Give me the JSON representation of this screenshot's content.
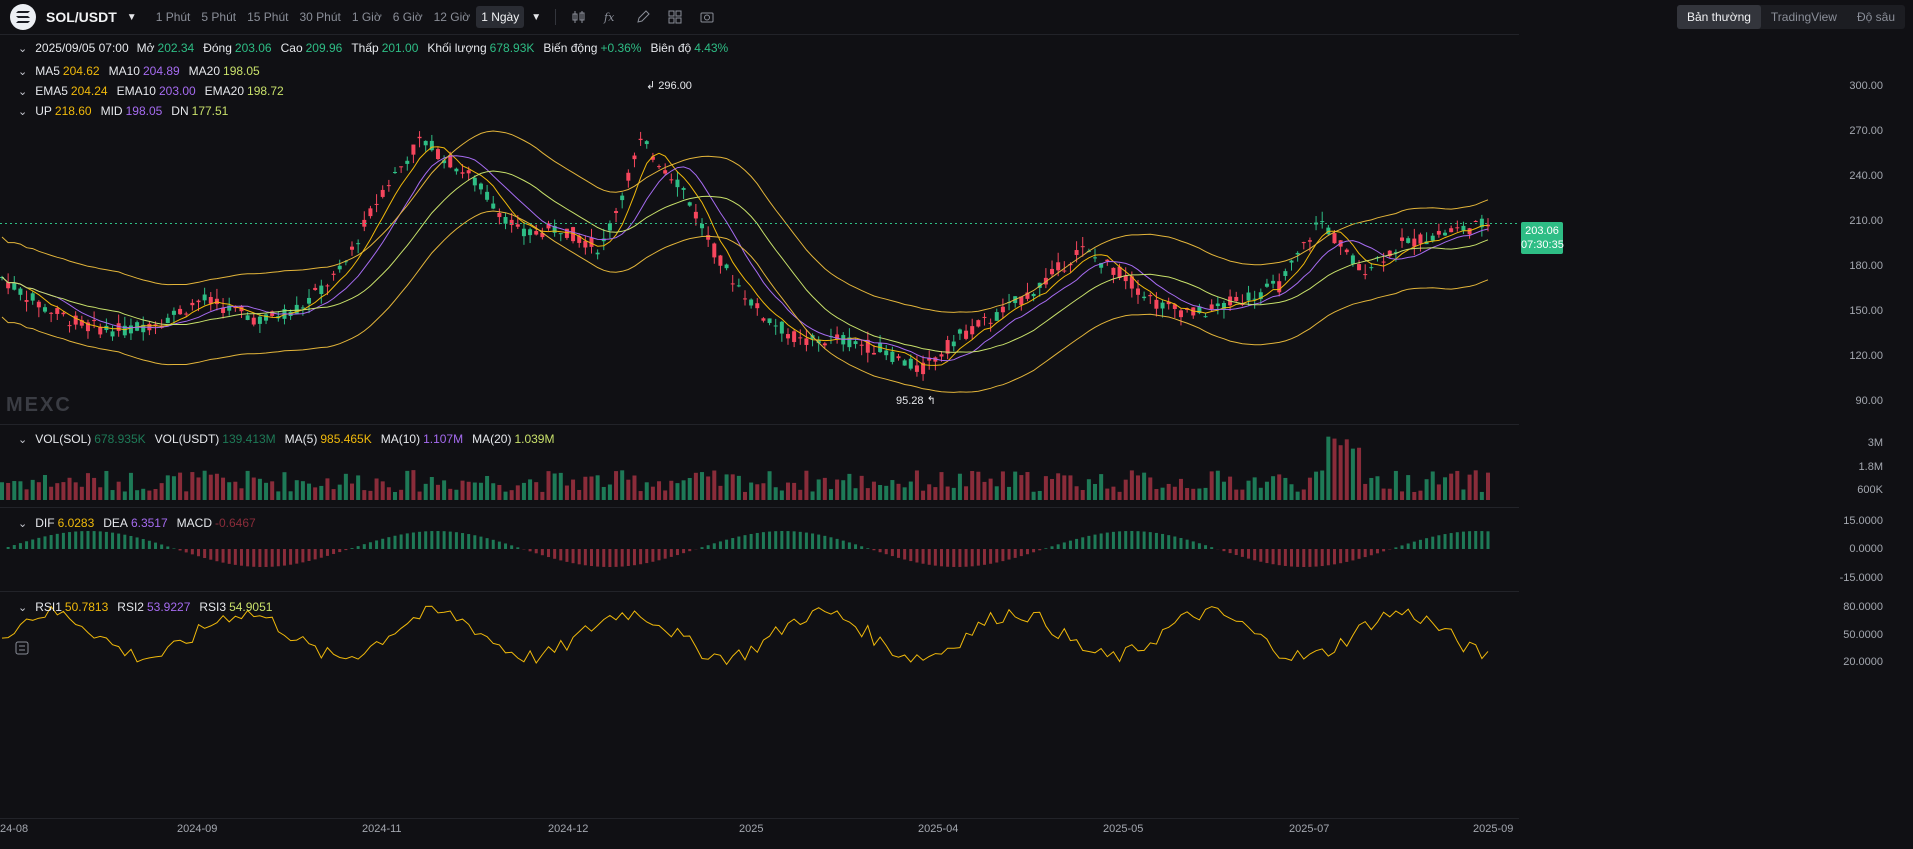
{
  "header": {
    "pair": "SOL/USDT",
    "timeframes": [
      "1 Phút",
      "5 Phút",
      "15 Phút",
      "30 Phút",
      "1 Giờ",
      "6 Giờ",
      "12 Giờ",
      "1 Ngày"
    ],
    "active_timeframe": "1 Ngày",
    "views": [
      "Bản thường",
      "TradingView",
      "Độ sâu"
    ],
    "active_view": "Bản thường"
  },
  "ohlc": {
    "date": "2025/09/05 07:00",
    "open_label": "Mở",
    "open": "202.34",
    "close_label": "Đóng",
    "close": "203.06",
    "high_label": "Cao",
    "high": "209.96",
    "low_label": "Thấp",
    "low": "201.00",
    "volume_label": "Khối lượng",
    "volume": "678.93K",
    "change_label": "Biến động",
    "change": "+0.36%",
    "amplitude_label": "Biên độ",
    "amplitude": "4.43%"
  },
  "ma": {
    "ma5_label": "MA5",
    "ma5": "204.62",
    "ma10_label": "MA10",
    "ma10": "204.89",
    "ma20_label": "MA20",
    "ma20": "198.05"
  },
  "ema": {
    "ema5_label": "EMA5",
    "ema5": "204.24",
    "ema10_label": "EMA10",
    "ema10": "203.00",
    "ema20_label": "EMA20",
    "ema20": "198.72"
  },
  "boll": {
    "up_label": "UP",
    "up": "218.60",
    "mid_label": "MID",
    "mid": "198.05",
    "dn_label": "DN",
    "dn": "177.51"
  },
  "vol": {
    "sol_label": "VOL(SOL)",
    "sol": "678.935K",
    "usdt_label": "VOL(USDT)",
    "usdt": "139.413M",
    "ma5_label": "MA(5)",
    "ma5": "985.465K",
    "ma10_label": "MA(10)",
    "ma10": "1.107M",
    "ma20_label": "MA(20)",
    "ma20": "1.039M"
  },
  "macd": {
    "dif_label": "DIF",
    "dif": "6.0283",
    "dea_label": "DEA",
    "dea": "6.3517",
    "macd_label": "MACD",
    "macd": "-0.6467"
  },
  "rsi": {
    "rsi1_label": "RSI1",
    "rsi1": "50.7813",
    "rsi2_label": "RSI2",
    "rsi2": "53.9227",
    "rsi3_label": "RSI3",
    "rsi3": "54.9051"
  },
  "price_axis": [
    "300.00",
    "270.00",
    "240.00",
    "210.00",
    "180.00",
    "150.00",
    "120.00",
    "90.00"
  ],
  "volume_axis": [
    "3M",
    "1.8M",
    "600K"
  ],
  "macd_axis": [
    "15.0000",
    "0.0000",
    "-15.0000"
  ],
  "rsi_axis": [
    "80.0000",
    "50.0000",
    "20.0000"
  ],
  "x_axis": [
    "24-08",
    "2024-09",
    "2024-11",
    "2024-12",
    "2025",
    "2025-04",
    "2025-05",
    "2025-07",
    "2025-09"
  ],
  "last_price": "203.06",
  "countdown": "07:30:35",
  "high_marker": "296.00",
  "low_marker": "95.28",
  "watermark": "MEXC",
  "colors": {
    "up": "#2ebd85",
    "down": "#f6465d",
    "ma5": "#f0b90b",
    "ma10": "#a56bf0",
    "ma20": "#c8e06a",
    "boll": "#e3b53a"
  }
}
